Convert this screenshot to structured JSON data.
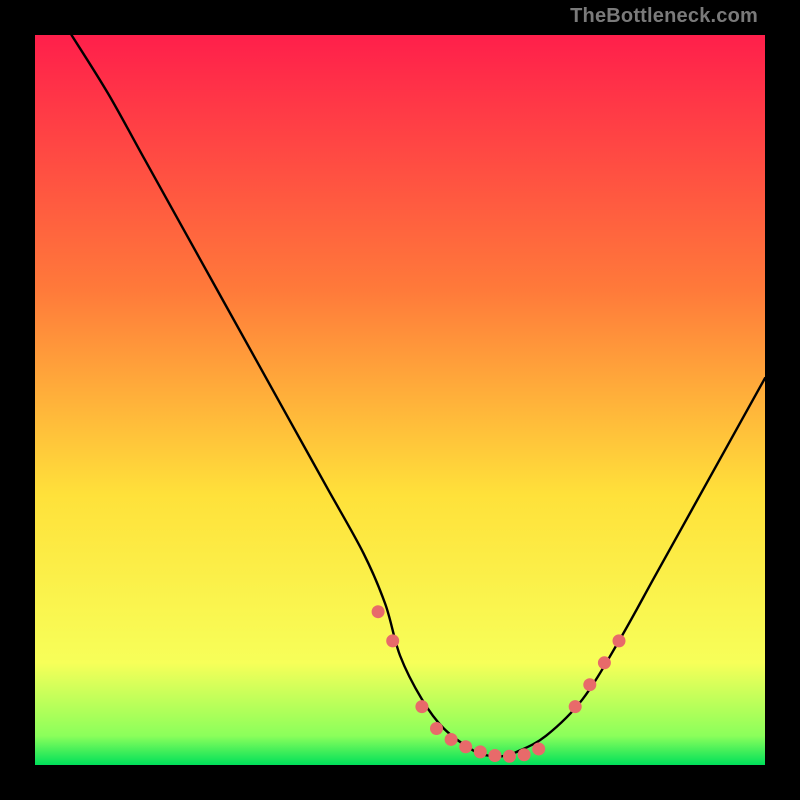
{
  "watermark": "TheBottleneck.com",
  "colors": {
    "gradient_top": "#ff1f4b",
    "gradient_mid1": "#ff7a3a",
    "gradient_mid2": "#ffe13a",
    "gradient_mid3": "#f7ff59",
    "gradient_bottom": "#00e05a",
    "curve": "#000000",
    "marker": "#e86a6a",
    "frame": "#000000"
  },
  "chart_data": {
    "type": "line",
    "title": "",
    "xlabel": "",
    "ylabel": "",
    "xlim": [
      0,
      100
    ],
    "ylim": [
      0,
      100
    ],
    "series": [
      {
        "name": "bottleneck-curve",
        "x": [
          5,
          10,
          15,
          20,
          25,
          30,
          35,
          40,
          45,
          48,
          50,
          53,
          56,
          60,
          62,
          64,
          66,
          70,
          75,
          80,
          85,
          90,
          95,
          100
        ],
        "y": [
          100,
          92,
          83,
          74,
          65,
          56,
          47,
          38,
          29,
          22,
          15,
          9,
          5,
          2,
          1.3,
          1.2,
          1.8,
          4,
          9,
          17,
          26,
          35,
          44,
          53
        ]
      }
    ],
    "markers": {
      "name": "highlighted-points",
      "x": [
        47,
        49,
        53,
        55,
        57,
        59,
        61,
        63,
        65,
        67,
        69,
        74,
        76,
        78,
        80
      ],
      "y": [
        21,
        17,
        8,
        5,
        3.5,
        2.5,
        1.8,
        1.3,
        1.2,
        1.4,
        2.2,
        8,
        11,
        14,
        17
      ]
    }
  }
}
